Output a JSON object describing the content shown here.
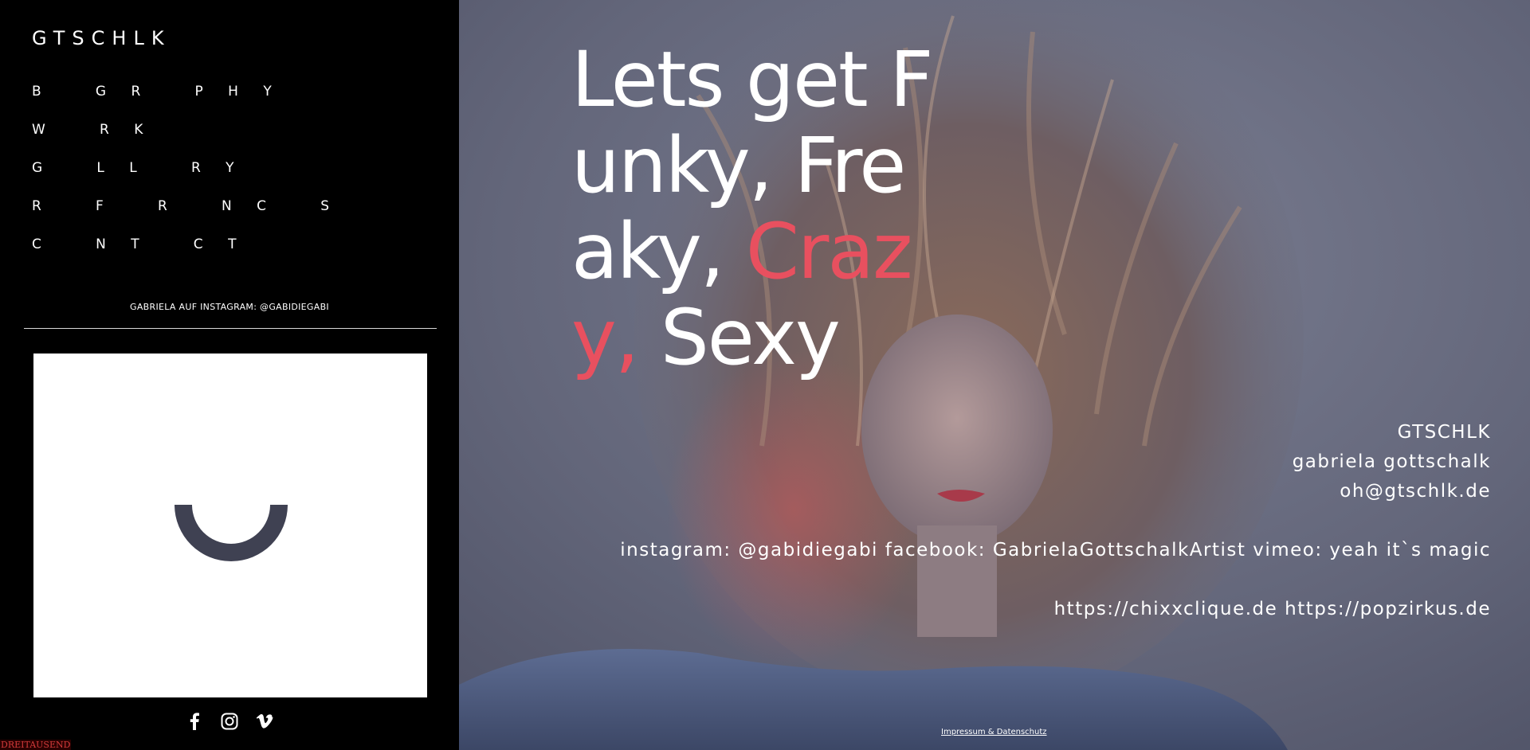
{
  "sidebar": {
    "logo": "GTSCHLK",
    "nav": [
      {
        "label": "B   G R   P H Y"
      },
      {
        "label": "W   R K"
      },
      {
        "label": "G   L L   R Y"
      },
      {
        "label": "R   F   R   N C   S"
      },
      {
        "label": "C   N T   C T"
      }
    ],
    "instagram_label": "GABRIELA AUF INSTAGRAM: @GABIDIEGABI",
    "social_icons": [
      "facebook-icon",
      "instagram-icon",
      "vimeo-icon"
    ],
    "corner_label": "DREITAUSEND"
  },
  "hero": {
    "headline": {
      "line1": "Lets get F",
      "line2": "unky, Fre",
      "line3_white": "aky, ",
      "line3_accent": "Craz",
      "line4_accent": "y,",
      "line4_white": " Sexy"
    },
    "accent_color": "#e8505f",
    "contact": {
      "name_short": "GTSCHLK",
      "name_full": "gabriela gottschalk",
      "email": "oh@gtschlk.de",
      "instagram": "instagram: @gabidiegabi",
      "facebook": "facebook: GabrielaGottschalkArtist",
      "vimeo": "vimeo: yeah it`s magic",
      "link1": "https://chixxclique.de",
      "link2": "https://popzirkus.de"
    },
    "footer_link": "Impressum & Datenschutz"
  }
}
